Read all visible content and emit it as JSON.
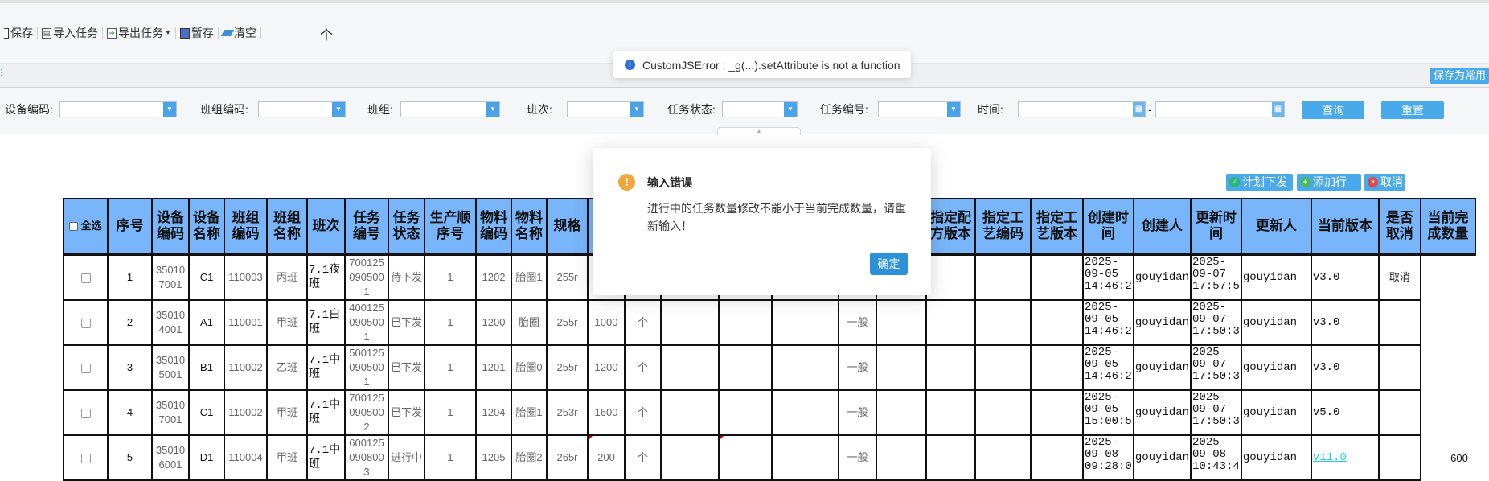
{
  "toolbar": {
    "save": "保存",
    "import": "导入任务",
    "export": "导出任务",
    "stash": "暂存",
    "clear": "清空",
    "unit_glyph": "个"
  },
  "save_common": "保存为常用",
  "filters": {
    "device_code": "设备编码:",
    "team_code": "班组编码:",
    "team": "班组:",
    "shift": "班次:",
    "task_status": "任务状态:",
    "task_no": "任务编号:",
    "time": "时间:",
    "time_sep": "-",
    "query": "查询",
    "reset": "重置"
  },
  "actions": {
    "dispatch": "计划下发",
    "add_row": "添加行",
    "cancel": "取消"
  },
  "toast": "CustomJSError : _g(...).setAttribute is not a function",
  "dialog": {
    "title": "输入错误",
    "message": "进行中的任务数量修改不能小于当前完成数量，请重新输入！",
    "ok": "确定"
  },
  "table": {
    "select_all": "全选",
    "columns": [
      "",
      "序号",
      "设备编码",
      "设备名称",
      "班组编码",
      "班组名称",
      "班次",
      "任务编号",
      "任务状态",
      "生产顺序号",
      "物料编码",
      "物料名称",
      "规格",
      "",
      "",
      "",
      "",
      "",
      "",
      "",
      "指定配方版本",
      "指定工艺编码",
      "指定工艺版本",
      "创建时间",
      "创建人",
      "更新时间",
      "更新人",
      "当前版本",
      "是否取消",
      "当前完成数量"
    ],
    "rows": [
      [
        "",
        "1",
        "350107001",
        "C1",
        "110003",
        "丙班",
        "7.1夜班",
        "7001250905001",
        "待下发",
        "1",
        "1202",
        "胎圈1",
        "255r",
        "",
        "",
        "",
        "",
        "",
        "",
        "",
        "",
        "",
        "",
        "2025-\n09-05\n14:46:2",
        "gouyidan",
        "2025-\n09-07\n17:57:5",
        "gouyidan",
        "v3.0",
        "取消",
        ""
      ],
      [
        "",
        "2",
        "350104001",
        "A1",
        "110001",
        "甲班",
        "7.1白班",
        "4001250905001",
        "已下发",
        "1",
        "1200",
        "胎圈",
        "255r",
        "1000",
        "个",
        "",
        "",
        "",
        "一般",
        "",
        "",
        "",
        "",
        "2025-\n09-05\n14:46:2",
        "gouyidan",
        "2025-\n09-07\n17:50:3",
        "gouyidan",
        "v3.0",
        "",
        ""
      ],
      [
        "",
        "3",
        "350105001",
        "B1",
        "110002",
        "乙班",
        "7.1中班",
        "5001250905001",
        "已下发",
        "1",
        "1201",
        "胎圈0",
        "255r",
        "1200",
        "个",
        "",
        "",
        "",
        "一般",
        "",
        "",
        "",
        "",
        "2025-\n09-05\n14:46:2",
        "gouyidan",
        "2025-\n09-07\n17:50:3",
        "gouyidan",
        "v3.0",
        "",
        ""
      ],
      [
        "",
        "4",
        "350107001",
        "C1",
        "110002",
        "甲班",
        "7.1中班",
        "7001250905002",
        "已下发",
        "1",
        "1204",
        "胎圈1",
        "253r",
        "1600",
        "个",
        "",
        "",
        "",
        "一般",
        "",
        "",
        "",
        "",
        "2025-\n09-05\n15:00:5",
        "gouyidan",
        "2025-\n09-07\n17:50:3",
        "gouyidan",
        "v5.0",
        "",
        ""
      ],
      [
        "",
        "5",
        "350106001",
        "D1",
        "110004",
        "甲班",
        "7.1中班",
        "6001250908003",
        "进行中",
        "1",
        "1205",
        "胎圈2",
        "265r",
        "200",
        "个",
        "",
        "",
        "",
        "一般",
        "",
        "",
        "",
        "",
        "2025-\n09-08\n09:28:0",
        "gouyidan",
        "2025-\n09-08\n10:43:4",
        "gouyidan",
        "v11.0",
        "",
        "600"
      ]
    ],
    "edited_cells": [
      [
        4,
        13
      ],
      [
        4,
        16
      ]
    ],
    "link_cells": [
      [
        4,
        27
      ]
    ]
  },
  "colors": {
    "header_bg": "#78b5fa",
    "button": "#4aa9ea",
    "dialog_ok": "#2b91d8",
    "warning": "#f0a83c",
    "edit_mark": "#cc0000"
  }
}
